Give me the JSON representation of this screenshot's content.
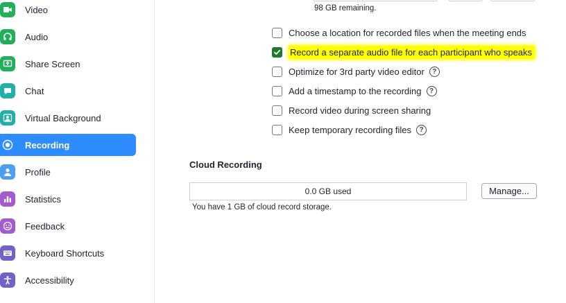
{
  "sidebar": {
    "items": [
      {
        "label": "Video",
        "icon": "video-icon",
        "color": "#20b05b"
      },
      {
        "label": "Audio",
        "icon": "headphones-icon",
        "color": "#20b05b"
      },
      {
        "label": "Share Screen",
        "icon": "share-screen-icon",
        "color": "#20b05b"
      },
      {
        "label": "Chat",
        "icon": "chat-icon",
        "color": "#21b0a8"
      },
      {
        "label": "Virtual Background",
        "icon": "virtual-background-icon",
        "color": "#21b0a8"
      },
      {
        "label": "Recording",
        "icon": "recording-icon",
        "color": "#2d8cff",
        "active": true
      },
      {
        "label": "Profile",
        "icon": "profile-icon",
        "color": "#4b9ef0"
      },
      {
        "label": "Statistics",
        "icon": "statistics-icon",
        "color": "#a25ccd"
      },
      {
        "label": "Feedback",
        "icon": "feedback-icon",
        "color": "#a25ccd"
      },
      {
        "label": "Keyboard Shortcuts",
        "icon": "keyboard-icon",
        "color": "#6f63c9"
      },
      {
        "label": "Accessibility",
        "icon": "accessibility-icon",
        "color": "#6f63c9"
      }
    ]
  },
  "local": {
    "remaining": "98 GB remaining."
  },
  "options": [
    {
      "label": "Choose a location for recorded files when the meeting ends",
      "checked": false,
      "help": false
    },
    {
      "label": "Record a separate audio file for each participant who speaks",
      "checked": true,
      "help": false,
      "highlighted": true
    },
    {
      "label": "Optimize for 3rd party video editor",
      "checked": false,
      "help": true
    },
    {
      "label": "Add a timestamp to the recording",
      "checked": false,
      "help": true
    },
    {
      "label": "Record video during screen sharing",
      "checked": false,
      "help": false
    },
    {
      "label": "Keep temporary recording files",
      "checked": false,
      "help": true
    }
  ],
  "cloud": {
    "title": "Cloud Recording",
    "used": "0.0 GB used",
    "manage_label": "Manage...",
    "note": "You have 1 GB of cloud record storage."
  },
  "colors": {
    "accent": "#2d8cff",
    "checkbox_checked": "#1f7a2d",
    "highlight": "#ffff00"
  }
}
